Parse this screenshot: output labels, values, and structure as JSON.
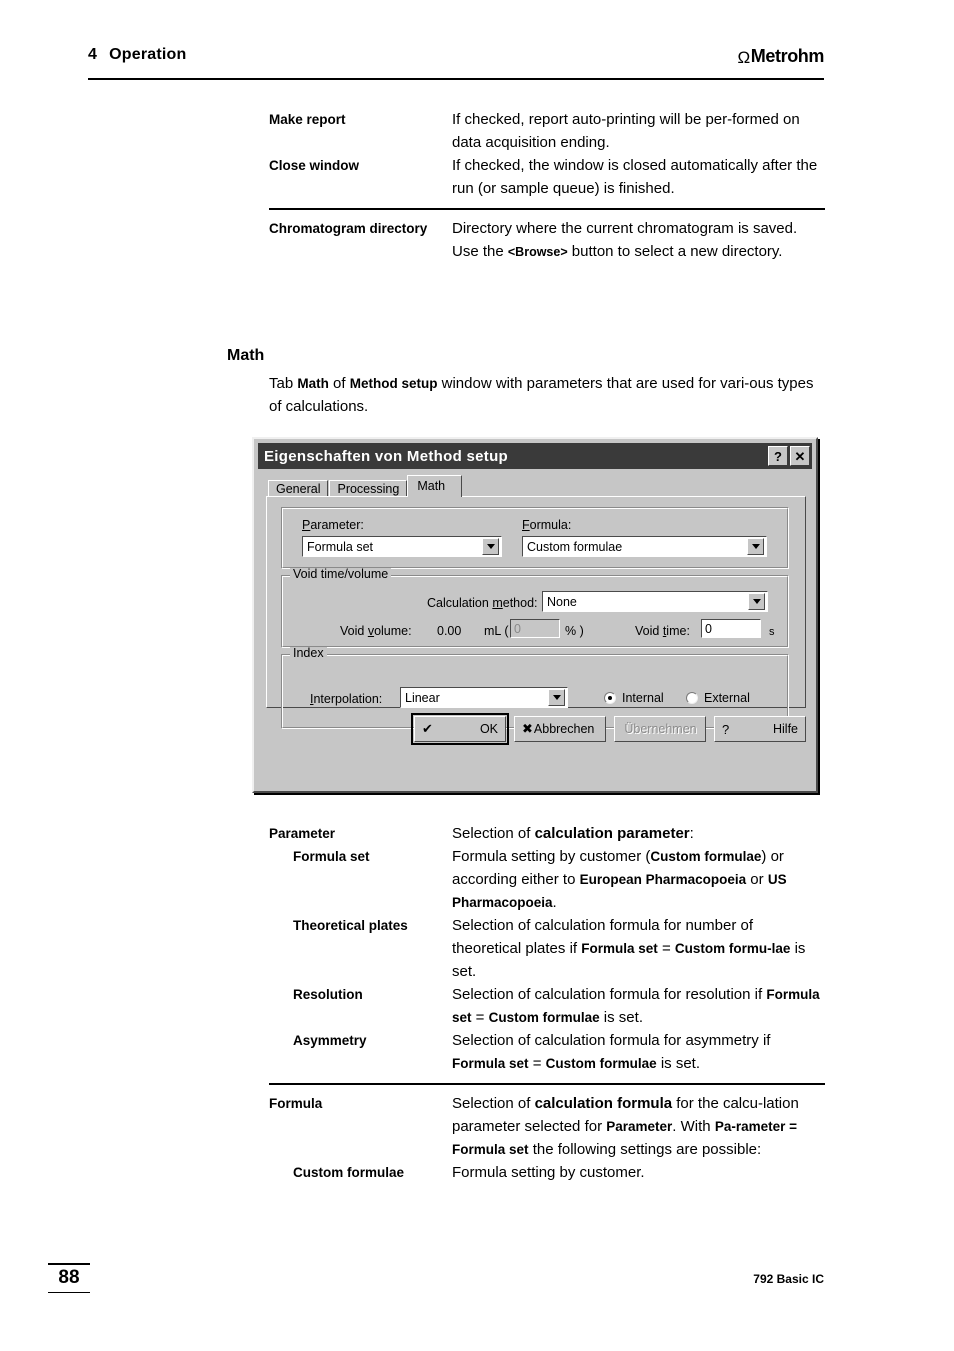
{
  "header": {
    "chapter_number": "4",
    "chapter_title": "Operation",
    "brand_omega": "Ω",
    "brand_name": "Metrohm"
  },
  "definitions_top": [
    {
      "term": "Make report",
      "desc_html": "If checked, report auto-printing will be per-formed on data acquisition ending."
    },
    {
      "term": "Close window",
      "desc_html": "If checked, the window is closed automatically after the run (or sample queue) is finished."
    }
  ],
  "definitions_chromatogram": {
    "term": "Chromatogram directory",
    "desc_pre": "Directory where the current chromatogram is saved. Use the ",
    "desc_bold": "<Browse>",
    "desc_post": " button to select a new directory."
  },
  "section": {
    "heading": "Math",
    "body_pre": "Tab ",
    "body_b1": "Math",
    "body_mid": " of ",
    "body_b2": "Method setup",
    "body_post": " window with parameters that are used for vari-ous types of calculations."
  },
  "dialog": {
    "title": "Eigenschaften von Method setup",
    "help_button": "?",
    "close_button": "✕",
    "tabs": [
      {
        "label": "General",
        "active": false
      },
      {
        "label": "Processing",
        "active": false
      },
      {
        "label": "Math",
        "active": true
      }
    ],
    "parameter_label": "Parameter:",
    "parameter_label_mnemonic": "P",
    "parameter_label_rest": "arameter:",
    "parameter_value": "Formula set",
    "formula_label_mnemonic": "F",
    "formula_label_rest": "ormula:",
    "formula_value": "Custom formulae",
    "void_group_legend": "Void time/volume",
    "calc_method_label_pre": "Calculation ",
    "calc_method_label_mn": "m",
    "calc_method_label_post": "ethod:",
    "calc_method_value": "None",
    "void_volume_label_pre": "Void ",
    "void_volume_label_mn": "v",
    "void_volume_label_post": "olume:",
    "void_volume_value": "0.00",
    "void_volume_unit": "mL (",
    "void_percent_value": "0",
    "void_percent_unit": "% )",
    "void_time_label_pre": "Void ",
    "void_time_label_mn": "t",
    "void_time_label_post": "ime:",
    "void_time_value": "0",
    "void_time_unit": "s",
    "index_group_legend": "Index",
    "interpolation_label_mn": "I",
    "interpolation_label_rest": "nterpolation:",
    "interpolation_value": "Linear",
    "radio_internal": "Internal",
    "radio_external": "External",
    "radio_selected": "Internal",
    "buttons": [
      {
        "icon": "✔",
        "label": "OK",
        "state": "default"
      },
      {
        "icon": "✖",
        "label": "Abbrechen",
        "state": "normal"
      },
      {
        "icon": "",
        "label": "Übernehmen",
        "state": "disabled"
      },
      {
        "icon": "?",
        "label": "Hilfe",
        "state": "normal"
      }
    ]
  },
  "definitions_bottom": [
    {
      "term": "Parameter",
      "indent": 0,
      "parts": [
        {
          "t": "Selection of ",
          "b": false
        },
        {
          "t": "calculation parameter",
          "b": true,
          "big": true
        },
        {
          "t": ":",
          "b": false
        }
      ]
    },
    {
      "term": "Formula set",
      "indent": 1,
      "parts": [
        {
          "t": "Formula setting by customer (",
          "b": false
        },
        {
          "t": "Custom formulae",
          "b": true
        },
        {
          "t": ") or according either to ",
          "b": false
        },
        {
          "t": "European Pharmacopoeia",
          "b": true
        },
        {
          "t": " or ",
          "b": false
        },
        {
          "t": "US Pharmacopoeia",
          "b": true
        },
        {
          "t": ".",
          "b": false
        }
      ]
    },
    {
      "term": "Theoretical plates",
      "indent": 1,
      "parts": [
        {
          "t": "Selection of calculation formula for number of theoretical plates if ",
          "b": false
        },
        {
          "t": "Formula set",
          "b": true
        },
        {
          "t": " = ",
          "b": false
        },
        {
          "t": "Custom formu-lae",
          "b": true
        },
        {
          "t": " is set.",
          "b": false
        }
      ]
    },
    {
      "term": "Resolution",
      "indent": 1,
      "parts": [
        {
          "t": "Selection of calculation formula for resolution if ",
          "b": false
        },
        {
          "t": "Formula set",
          "b": true
        },
        {
          "t": " = ",
          "b": false
        },
        {
          "t": "Custom formulae",
          "b": true
        },
        {
          "t": " is set.",
          "b": false
        }
      ]
    },
    {
      "term": "Asymmetry",
      "indent": 1,
      "parts": [
        {
          "t": "Selection of calculation formula for asymmetry if ",
          "b": false
        },
        {
          "t": "Formula set",
          "b": true
        },
        {
          "t": " = ",
          "b": false
        },
        {
          "t": "Custom formulae",
          "b": true
        },
        {
          "t": " is set.",
          "b": false
        }
      ]
    },
    {
      "term": "Formula",
      "indent": 0,
      "rule_above": true,
      "parts": [
        {
          "t": "Selection of ",
          "b": false
        },
        {
          "t": "calculation formula",
          "b": true,
          "big": true
        },
        {
          "t": " for the calcu-lation parameter selected for ",
          "b": false
        },
        {
          "t": "Parameter",
          "b": true
        },
        {
          "t": ". With ",
          "b": false
        },
        {
          "t": "Pa-rameter = Formula set",
          "b": true
        },
        {
          "t": " the following settings are possible:",
          "b": false
        }
      ]
    },
    {
      "term": "Custom formulae",
      "indent": 1,
      "parts": [
        {
          "t": "Formula setting by customer.",
          "b": false
        }
      ]
    }
  ],
  "footer": {
    "page_number": "88",
    "product": "792 Basic IC"
  }
}
